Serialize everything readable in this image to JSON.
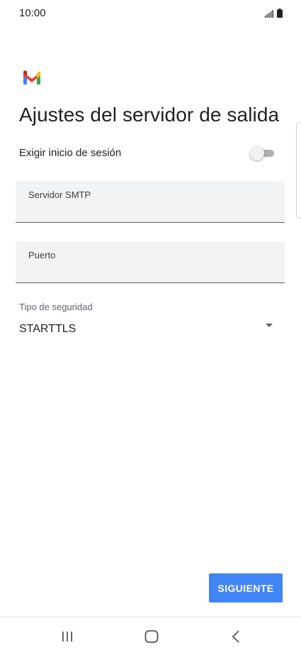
{
  "status_bar": {
    "time": "10:00",
    "icons": [
      "signal-icon",
      "battery-icon"
    ]
  },
  "app": {
    "logo": "gmail-logo",
    "colors": {
      "red": "#ea4335",
      "blue": "#4285f4",
      "green": "#34a853",
      "yellow": "#fbbc04"
    }
  },
  "page": {
    "title": "Ajustes del servidor de salida"
  },
  "signin": {
    "label": "Exigir inicio de sesión",
    "enabled": false
  },
  "smtp": {
    "label": "Servidor SMTP",
    "value": ""
  },
  "port": {
    "label": "Puerto",
    "value": ""
  },
  "security": {
    "label": "Tipo de seguridad",
    "selected": "STARTTLS"
  },
  "actions": {
    "next_label": "SIGUIENTE",
    "accent_color": "#4285f4"
  },
  "nav": {
    "icons": [
      "recents-icon",
      "home-icon",
      "back-icon"
    ]
  }
}
